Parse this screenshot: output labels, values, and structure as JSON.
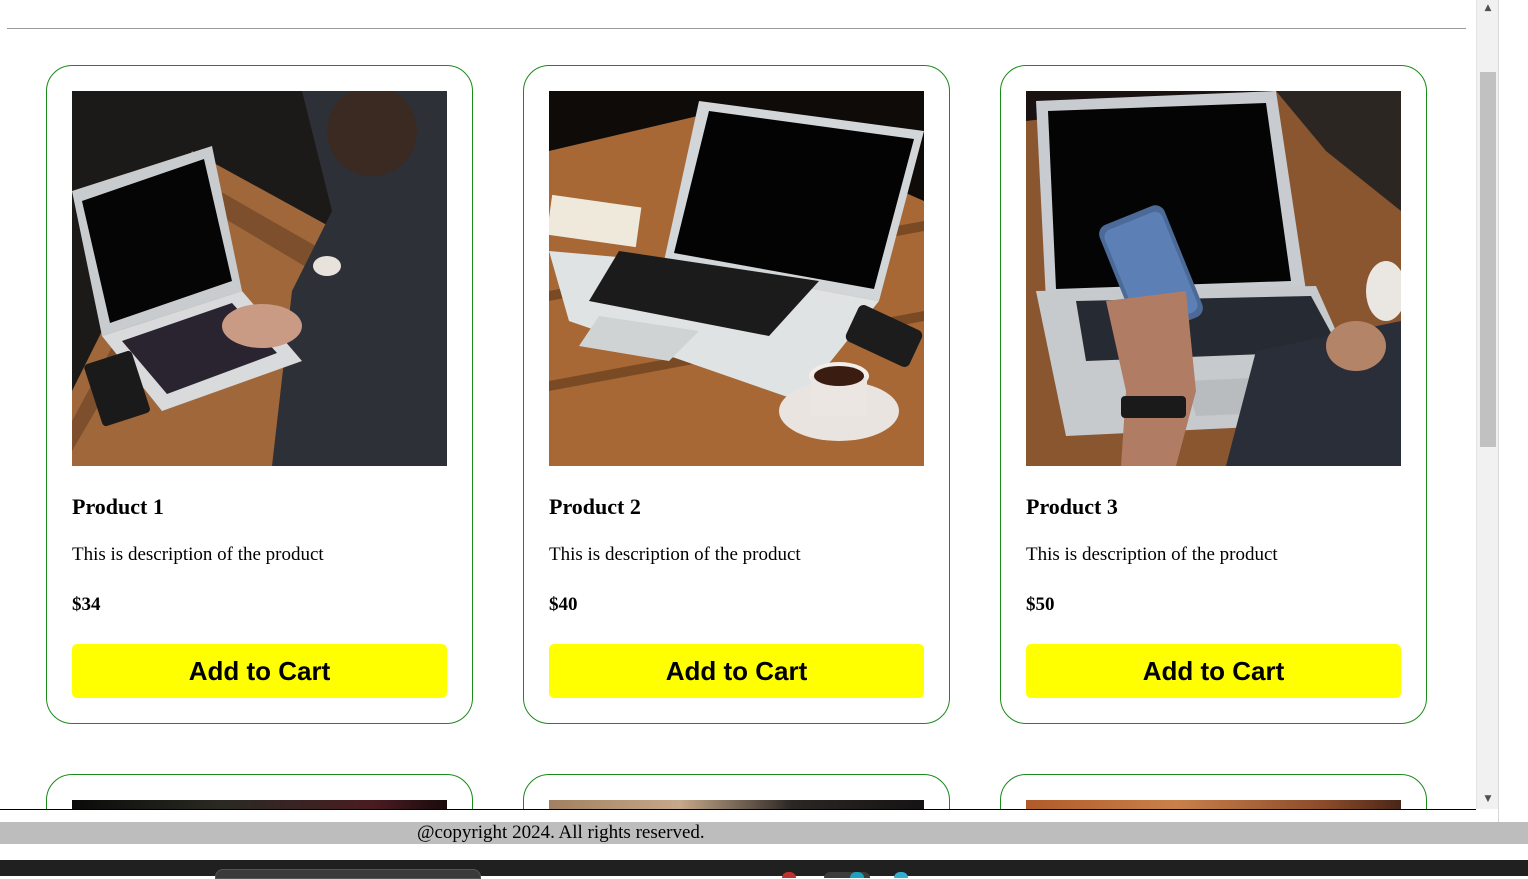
{
  "products": [
    {
      "name": "Product 1",
      "description": "This is description of the product",
      "price": "$34",
      "button_label": "Add to Cart",
      "image": "laptop-typing-photo"
    },
    {
      "name": "Product 2",
      "description": "This is description of the product",
      "price": "$40",
      "button_label": "Add to Cart",
      "image": "laptop-coffee-photo"
    },
    {
      "name": "Product 3",
      "description": "This is description of the product",
      "price": "$50",
      "button_label": "Add to Cart",
      "image": "laptop-phone-photo"
    }
  ],
  "footer": {
    "copyright": "@copyright 2024. All rights reserved."
  },
  "colors": {
    "card_border": "#1a8a1a",
    "button_bg": "#ffff00",
    "footer_bg": "#bdbdbd"
  },
  "scrollbar": {
    "up_icon": "triangle-up-icon",
    "down_icon": "triangle-down-icon"
  }
}
